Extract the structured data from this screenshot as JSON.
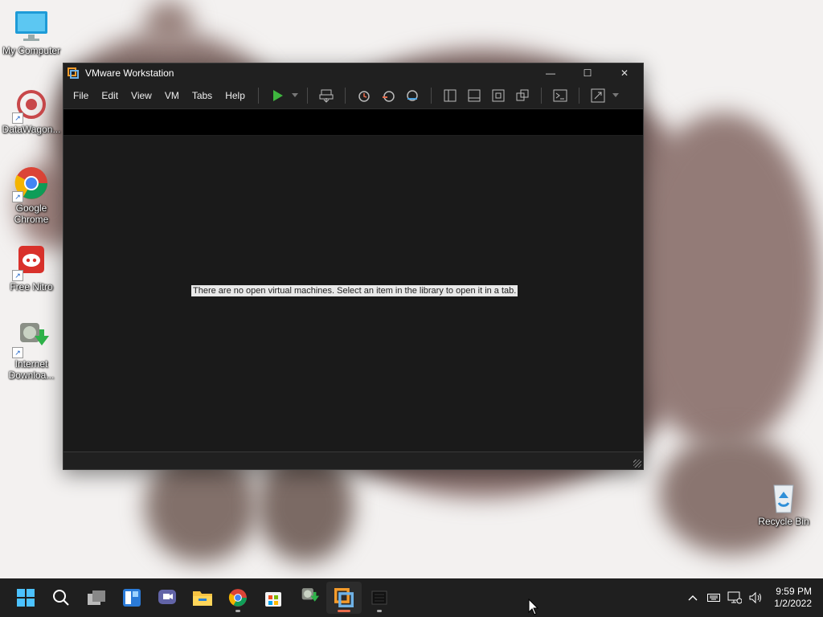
{
  "desktop": {
    "icons": [
      {
        "label": "My Computer",
        "icon": "monitor-icon"
      },
      {
        "label": "DataWagon...",
        "icon": "datawagon-icon"
      },
      {
        "label": "Google Chrome",
        "icon": "chrome-icon"
      },
      {
        "label": "Free Nitro",
        "icon": "discord-icon"
      },
      {
        "label": "Internet Downloa...",
        "icon": "internet-download-manager-icon"
      },
      {
        "label": "Recycle Bin",
        "icon": "recycle-bin-icon"
      }
    ]
  },
  "window": {
    "title": "VMware Workstation",
    "controls": {
      "minimize": "—",
      "maximize": "☐",
      "close": "✕"
    },
    "menu": [
      "File",
      "Edit",
      "View",
      "VM",
      "Tabs",
      "Help"
    ],
    "empty_message": "There are no open virtual machines. Select an item in the library to open it in a tab."
  },
  "taskbar": {
    "apps": [
      "start",
      "search",
      "task-view",
      "widgets",
      "teams-chat",
      "file-explorer",
      "chrome",
      "microsoft-store",
      "internet-download-manager",
      "vmware-workstation",
      "blank-app"
    ],
    "active_app": "vmware-workstation",
    "clock": {
      "time": "9:59 PM",
      "date": "1/2/2022"
    }
  },
  "colors": {
    "window_bg": "#202020",
    "content_bg": "#1a1a1a",
    "accent": "#e86b4c",
    "play_green": "#3fb63f",
    "wallpaper_hippo": "#8f7774"
  }
}
